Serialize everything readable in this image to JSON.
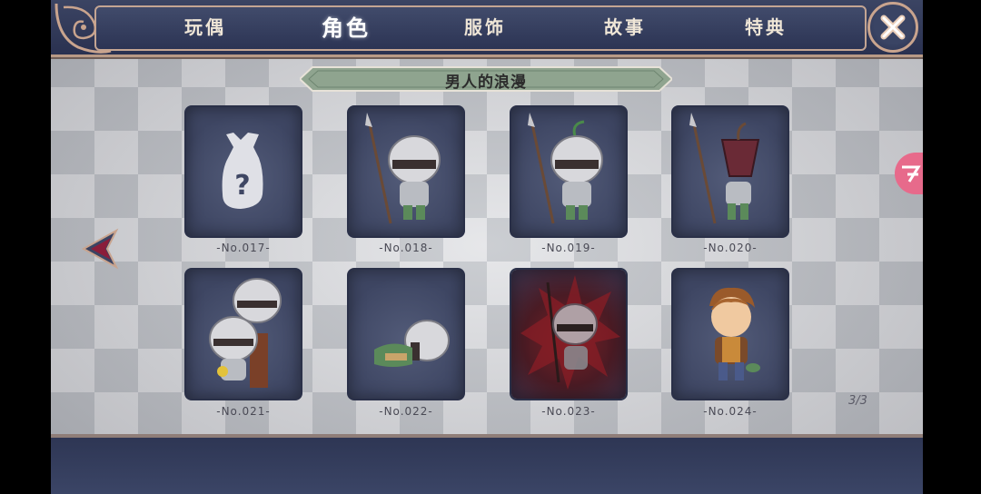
{
  "tabs": [
    {
      "label": "玩偶",
      "active": false
    },
    {
      "label": "角色",
      "active": true
    },
    {
      "label": "服饰",
      "active": false
    },
    {
      "label": "故事",
      "active": false
    },
    {
      "label": "特典",
      "active": false
    }
  ],
  "section_title": "男人的浪漫",
  "cards": [
    {
      "label": "-No.017-",
      "locked": true
    },
    {
      "label": "-No.018-",
      "locked": false
    },
    {
      "label": "-No.019-",
      "locked": false
    },
    {
      "label": "-No.020-",
      "locked": false
    },
    {
      "label": "-No.021-",
      "locked": false
    },
    {
      "label": "-No.022-",
      "locked": false
    },
    {
      "label": "-No.023-",
      "locked": false
    },
    {
      "label": "-No.024-",
      "locked": false
    }
  ],
  "page_indicator": "3/3",
  "icons": {
    "close": "close-icon",
    "prev": "left-arrow-icon",
    "side": "side-menu-icon",
    "locked": "locked-question-icon"
  },
  "colors": {
    "panel": "#3e4663",
    "bar": "#2c3454",
    "frame": "#c4a593",
    "banner": "#8fa48f",
    "side_icon": "#e76a8b"
  }
}
